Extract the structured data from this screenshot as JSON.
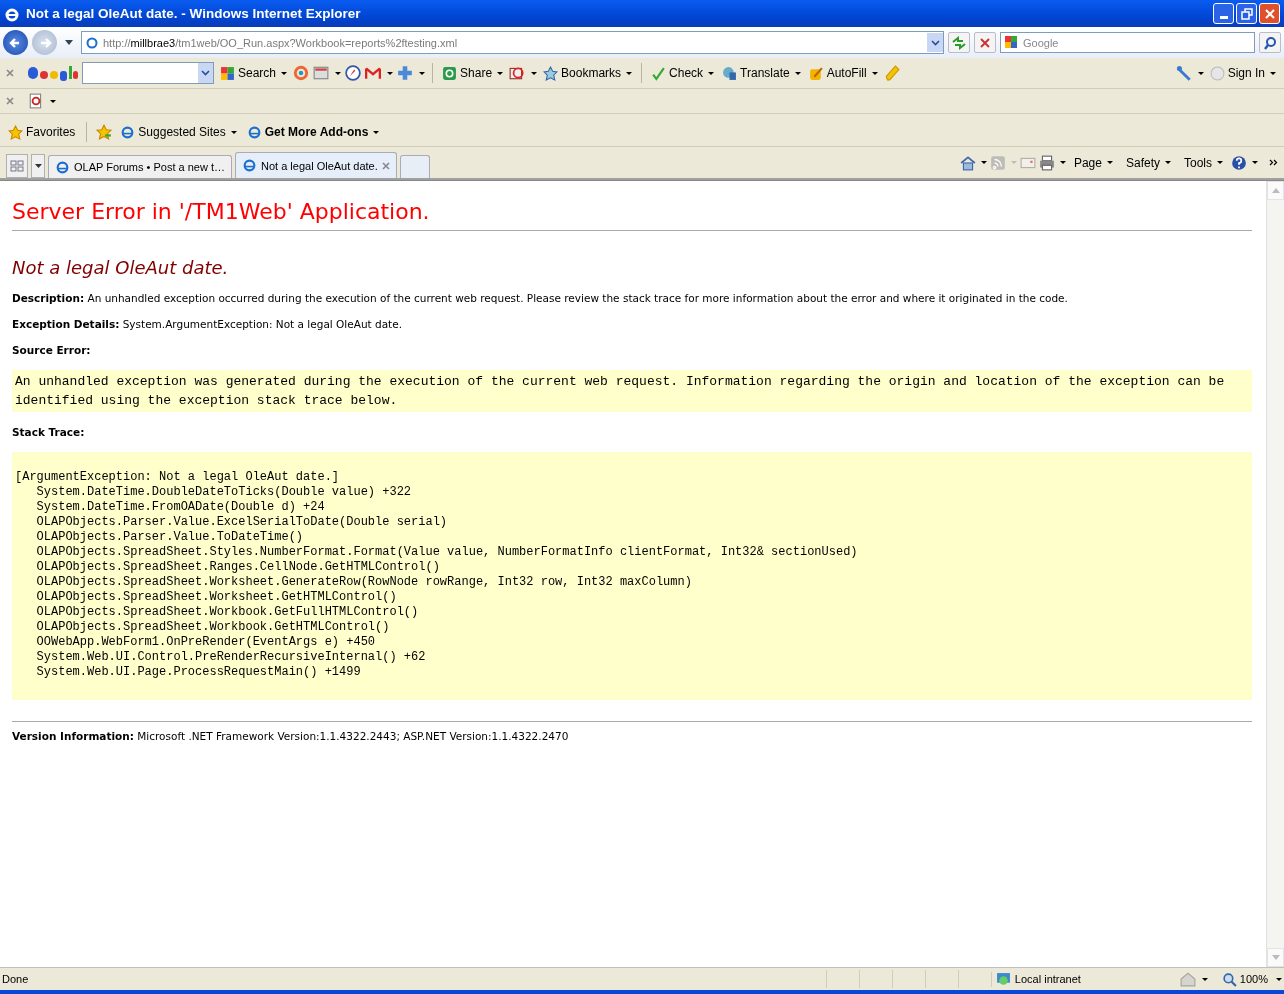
{
  "window": {
    "title": "Not a legal OleAut date. - Windows Internet Explorer"
  },
  "address": {
    "scheme": "http://",
    "host": "millbrae3",
    "path": "/tm1web/OO_Run.aspx?Workbook=reports%2ftesting.xml"
  },
  "search": {
    "placeholder": "Google"
  },
  "google_toolbar": {
    "buttons": [
      {
        "label": "Search"
      },
      {
        "label": "Share"
      },
      {
        "label": "Bookmarks"
      },
      {
        "label": "Check"
      },
      {
        "label": "Translate"
      },
      {
        "label": "AutoFill"
      },
      {
        "label": "Sign In"
      }
    ]
  },
  "favorites_bar": {
    "favorites": "Favorites",
    "links": [
      {
        "label": "Suggested Sites",
        "bold": false
      },
      {
        "label": "Get More Add-ons",
        "bold": true
      }
    ]
  },
  "tabs": [
    {
      "label": "OLAP Forums • Post a new t…",
      "selected": false
    },
    {
      "label": "Not a legal OleAut date.",
      "selected": true
    }
  ],
  "command_bar": [
    "Page",
    "Safety",
    "Tools"
  ],
  "error": {
    "title": "Server Error in '/TM1Web' Application.",
    "subtitle": "Not a legal OleAut date.",
    "description": "**Description:** An unhandled exception occurred during the execution of the current web request. Please review the stack trace for more information about the error and where it originated in the code.",
    "details": "**Exception Details:** System.ArgumentException: Not a legal OleAut date.",
    "source_label": "Source Error:",
    "source_text": "An unhandled exception was generated during the execution of the current web request. Information regarding the origin and location of the exception can be identified using the exception stack trace below.",
    "stack_label": "Stack Trace:",
    "stack": [
      "[ArgumentException: Not a legal OleAut date.]",
      "   System.DateTime.DoubleDateToTicks(Double value) +322",
      "   System.DateTime.FromOADate(Double d) +24",
      "   OLAPObjects.Parser.Value.ExcelSerialToDate(Double serial)",
      "   OLAPObjects.Parser.Value.ToDateTime()",
      "   OLAPObjects.SpreadSheet.Styles.NumberFormat.Format(Value value, NumberFormatInfo clientFormat, Int32& sectionUsed)",
      "   OLAPObjects.SpreadSheet.Ranges.CellNode.GetHTMLControl()",
      "   OLAPObjects.SpreadSheet.Worksheet.GenerateRow(RowNode rowRange, Int32 row, Int32 maxColumn)",
      "   OLAPObjects.SpreadSheet.Worksheet.GetHTMLControl()",
      "   OLAPObjects.SpreadSheet.Workbook.GetFullHTMLControl()",
      "   OLAPObjects.SpreadSheet.Workbook.GetHTMLControl()",
      "   OOWebApp.WebForm1.OnPreRender(EventArgs e) +450",
      "   System.Web.UI.Control.PreRenderRecursiveInternal() +62",
      "   System.Web.UI.Page.ProcessRequestMain() +1499"
    ],
    "version": "**Version Information:** Microsoft .NET Framework Version:1.1.4322.2443; ASP.NET Version:1.1.4322.2470"
  },
  "status_bar": {
    "text": "Done",
    "zone": "Local intranet",
    "zoom": "100%"
  }
}
